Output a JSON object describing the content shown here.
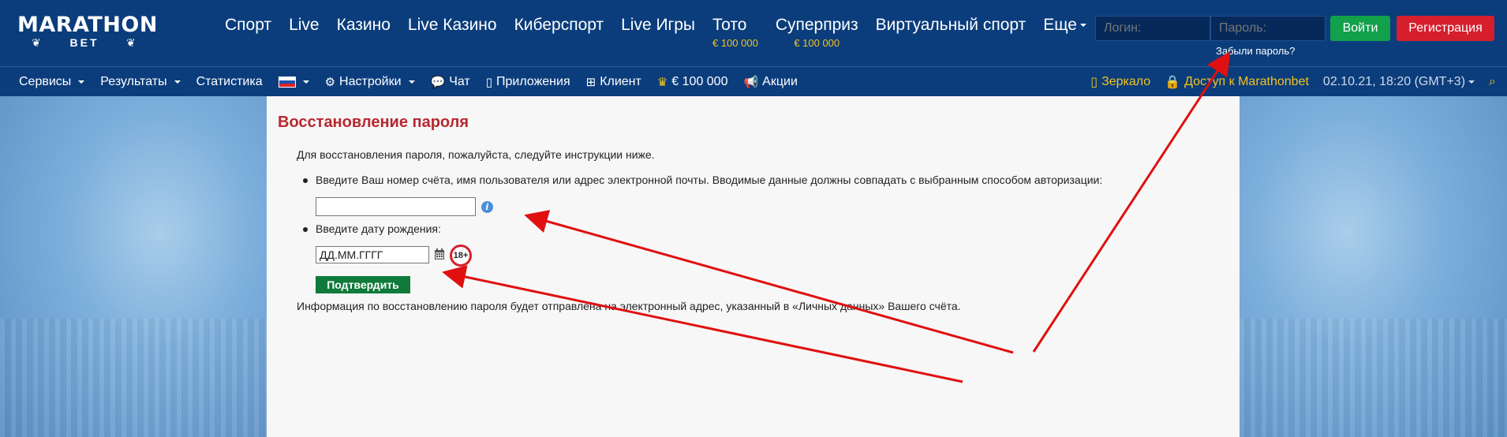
{
  "header": {
    "logo_main": "MARATHON",
    "logo_sub": "BET",
    "nav": [
      {
        "label": "Спорт",
        "sub": ""
      },
      {
        "label": "Live",
        "sub": ""
      },
      {
        "label": "Казино",
        "sub": ""
      },
      {
        "label": "Live Казино",
        "sub": ""
      },
      {
        "label": "Киберспорт",
        "sub": ""
      },
      {
        "label": "Live Игры",
        "sub": ""
      },
      {
        "label": "Тото",
        "sub": "€ 100 000"
      },
      {
        "label": "Суперприз",
        "sub": "€ 100 000"
      },
      {
        "label": "Виртуальный спорт",
        "sub": ""
      },
      {
        "label": "Еще",
        "sub": ""
      }
    ],
    "login_placeholder": "Логин:",
    "password_placeholder": "Пароль:",
    "login_button": "Войти",
    "register_button": "Регистрация",
    "forgot_password": "Забыли пароль?"
  },
  "subnav": {
    "items": [
      {
        "label": "Сервисы"
      },
      {
        "label": "Результаты"
      },
      {
        "label": "Статистика"
      },
      {
        "label": "Настройки"
      },
      {
        "label": "Чат"
      },
      {
        "label": "Приложения"
      },
      {
        "label": "Клиент"
      },
      {
        "label": "€ 100 000"
      },
      {
        "label": "Акции"
      }
    ],
    "mirror": "Зеркало",
    "access": "Доступ к Marathonbet",
    "datetime": "02.10.21, 18:20 (GMT+3)"
  },
  "recovery": {
    "title": "Восстановление пароля",
    "intro": "Для восстановления пароля, пожалуйста, следуйте инструкции ниже.",
    "step1": "Введите Ваш номер счёта, имя пользователя или адрес электронной почты. Вводимые данные должны совпадать с выбранным способом авторизации:",
    "step2": "Введите дату рождения:",
    "date_value": "ДД.ММ.ГГГГ",
    "age_badge": "18+",
    "confirm_button": "Подтвердить",
    "note": "Информация по восстановлению пароля будет отправлена на электронный адрес, указанный в «Личных данных» Вашего счёта."
  },
  "colors": {
    "header_bg": "#0b3d7c",
    "accent_yellow": "#f3c31b",
    "title_red": "#b8272f",
    "login_green": "#12a04b",
    "register_red": "#d51f2d",
    "arrow_red": "#e01010"
  }
}
